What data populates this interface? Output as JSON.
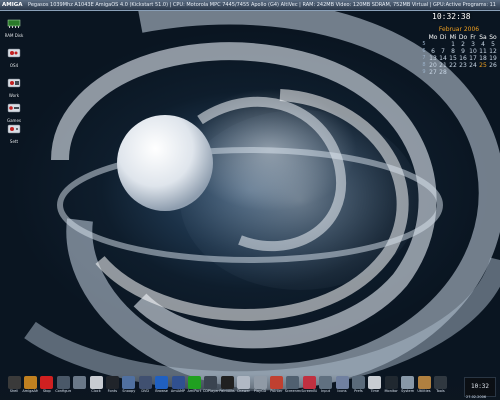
{
  "topbar": {
    "logo": "AMIGA",
    "sysinfo": "Pegasos 1039Mhz A1043E AmigaOS 4.0 (Kickstart 51.0) | CPU: Motorola MPC 7445/7455 Apollo (G4) AltiVec | RAM: 242MB Video: 120MB SDRAM, 752MB Virtual | GPU: Radeon 9200",
    "active_programs": "Active Programs: 11"
  },
  "clock": "10:32:38",
  "calendar": {
    "month": "Februar 2006",
    "days": [
      "Mo",
      "Di",
      "Mi",
      "Do",
      "Fr",
      "Sa",
      "So"
    ],
    "weeks": [
      {
        "wk": "5",
        "d": [
          "",
          "",
          "1",
          "2",
          "3",
          "4",
          "5"
        ]
      },
      {
        "wk": "6",
        "d": [
          "6",
          "7",
          "8",
          "9",
          "10",
          "11",
          "12"
        ]
      },
      {
        "wk": "7",
        "d": [
          "13",
          "14",
          "15",
          "16",
          "17",
          "18",
          "19"
        ]
      },
      {
        "wk": "8",
        "d": [
          "20",
          "21",
          "22",
          "23",
          "24",
          "25",
          "26"
        ]
      },
      {
        "wk": "9",
        "d": [
          "27",
          "28",
          "",
          "",
          "",
          "",
          ""
        ]
      }
    ],
    "today_index": [
      3,
      5
    ]
  },
  "desktop_icons": [
    {
      "name": "RAM Disk",
      "icon": "ramdisk-icon"
    },
    {
      "name": "OS4",
      "icon": "drive-icon"
    },
    {
      "name": "Work",
      "icon": "drive-icon"
    },
    {
      "name": "Games",
      "icon": "drive-icon"
    },
    {
      "name": "Sett",
      "icon": "drive-icon"
    }
  ],
  "dock": {
    "items": [
      {
        "label": "Shell",
        "color": "#3a3a3a"
      },
      {
        "label": "AmigaAMP",
        "color": "#c08020"
      },
      {
        "label": "Stop",
        "color": "#d02020"
      },
      {
        "label": "Configure",
        "color": "#4a5868"
      },
      {
        "label": "",
        "color": "#6a7888"
      },
      {
        "label": "Clock",
        "color": "#c8ccd2"
      },
      {
        "label": "Fonts",
        "color": "#20242a"
      },
      {
        "label": "Snoopy",
        "color": "#5070a0"
      },
      {
        "label": "DVD",
        "color": "#405070"
      },
      {
        "label": "Browse",
        "color": "#2060c0"
      },
      {
        "label": "AmiAMP",
        "color": "#305090"
      },
      {
        "label": "AmiPort",
        "color": "#20a020"
      },
      {
        "label": "CDPlayer",
        "color": "#3a4450"
      },
      {
        "label": "PaintAlbums",
        "color": "#202020"
      },
      {
        "label": "Drawer",
        "color": "#b0b8c4"
      },
      {
        "label": "PlayCD",
        "color": "#909aa6"
      },
      {
        "label": "Pointer",
        "color": "#c04030"
      },
      {
        "label": "Screenmode",
        "color": "#506070"
      },
      {
        "label": "ScreenBlank",
        "color": "#c03040"
      },
      {
        "label": "Input",
        "color": "#607080"
      },
      {
        "label": "Icons",
        "color": "#7080a0"
      },
      {
        "label": "Prefs",
        "color": "#5a6a7a"
      },
      {
        "label": "Time",
        "color": "#c8ccd2"
      },
      {
        "label": "Monitor",
        "color": "#202830"
      },
      {
        "label": "System",
        "color": "#8898a8"
      },
      {
        "label": "Utilities",
        "color": "#b08040"
      },
      {
        "label": "Tools",
        "color": "#303840"
      }
    ],
    "clock": "10:32",
    "date": "27.02.2006"
  }
}
